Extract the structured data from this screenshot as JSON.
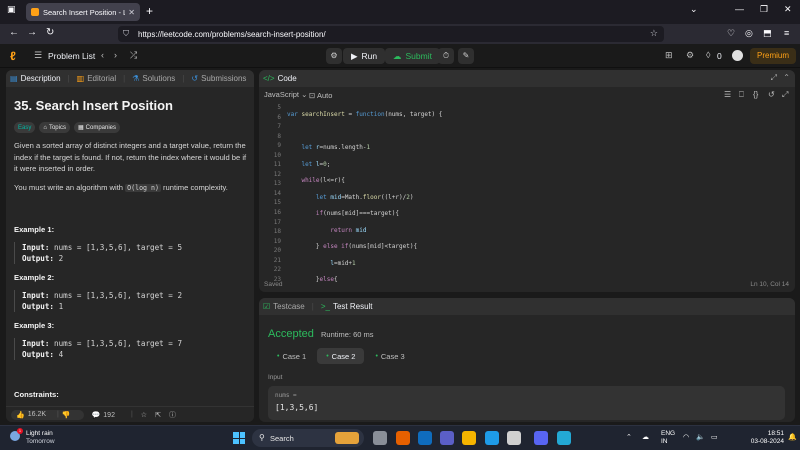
{
  "browser": {
    "tab_title": "Search Insert Position - LeetCode",
    "url": "https://leetcode.com/problems/search-insert-position/"
  },
  "header": {
    "problem_list": "Problem List",
    "run": "Run",
    "submit": "Submit",
    "streak": "0",
    "premium": "Premium"
  },
  "left_tabs": [
    "Description",
    "Editorial",
    "Solutions",
    "Submissions"
  ],
  "problem": {
    "title": "35. Search Insert Position",
    "difficulty": "Easy",
    "topics": "Topics",
    "companies": "Companies",
    "statement": "Given a sorted array of distinct integers and a target value, return the index if the target is found. If not, return the index where it would be if it were inserted in order.",
    "complexity_pre": "You must write an algorithm with ",
    "complexity_code": "O(log n)",
    "complexity_post": " runtime complexity.",
    "examples": [
      {
        "title": "Example 1:",
        "input": "nums = [1,3,5,6], target = 5",
        "output": "2"
      },
      {
        "title": "Example 2:",
        "input": "nums = [1,3,5,6], target = 2",
        "output": "1"
      },
      {
        "title": "Example 3:",
        "input": "nums = [1,3,5,6], target = 7",
        "output": "4"
      }
    ],
    "input_label": "Input:",
    "output_label": "Output:",
    "constraints": "Constraints:",
    "likes": "16.2K",
    "comments": "192"
  },
  "code": {
    "tab": "Code",
    "language": "JavaScript",
    "auto": "Auto",
    "saved": "Saved",
    "cursor": "Ln 10, Col 14",
    "line_numbers": [
      "5",
      "6",
      "7",
      "8",
      "9",
      "10",
      "11",
      "12",
      "13",
      "14",
      "15",
      "16",
      "17",
      "18",
      "19",
      "20",
      "21",
      "22",
      "23"
    ]
  },
  "result": {
    "tab_testcase": "Testcase",
    "tab_result": "Test Result",
    "status": "Accepted",
    "runtime": "Runtime: 60 ms",
    "cases": [
      "Case 1",
      "Case 2",
      "Case 3"
    ],
    "input_label": "Input",
    "var_label": "nums =",
    "var_value": "[1,3,5,6]"
  },
  "taskbar": {
    "weather_1": "Light rain",
    "weather_2": "Tomorrow",
    "search": "Search",
    "lang_1": "ENG",
    "lang_2": "IN",
    "time": "18:51",
    "date": "03-08-2024",
    "notif": "1"
  }
}
